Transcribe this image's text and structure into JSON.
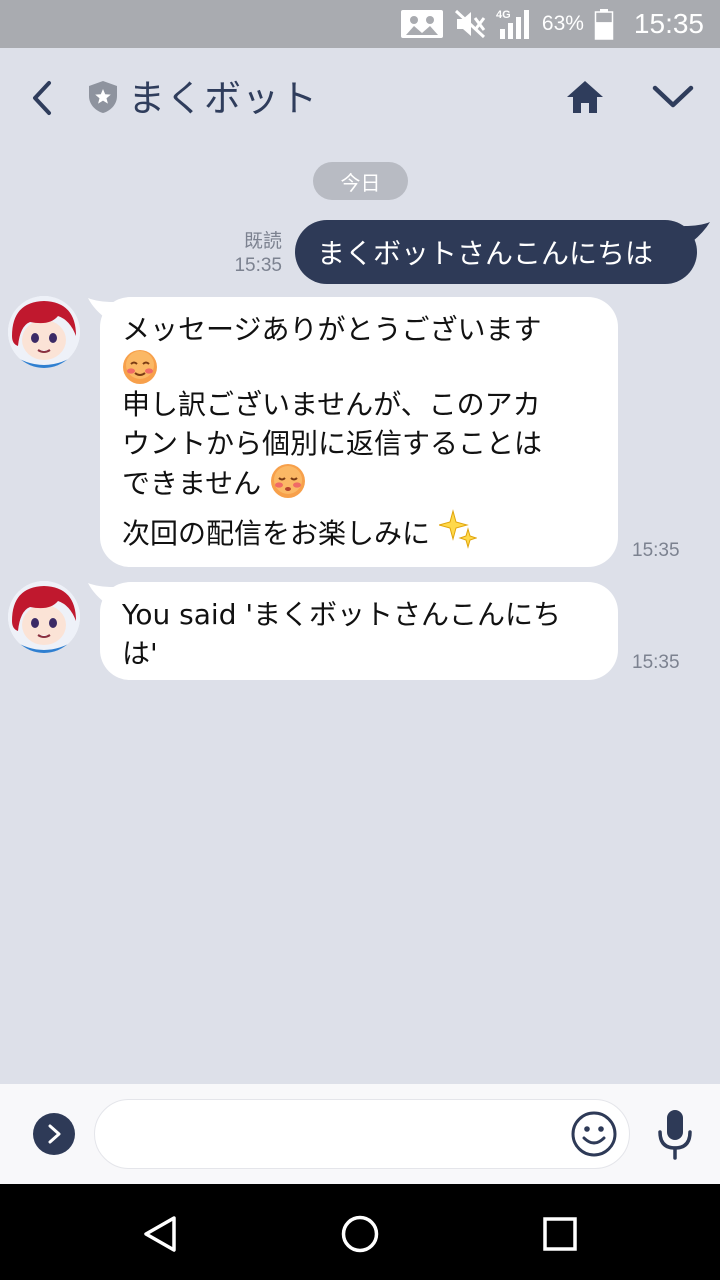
{
  "status_bar": {
    "network": "4G",
    "battery_pct": "63%",
    "battery_level": 63,
    "time": "15:35",
    "icons": [
      "photo-icon",
      "mute-icon",
      "signal-icon",
      "battery-icon"
    ]
  },
  "header": {
    "title": "まくボット",
    "icons": [
      "back-icon",
      "shield-icon",
      "home-icon",
      "chevron-down-icon"
    ]
  },
  "date_pill": "今日",
  "messages": {
    "sent": {
      "text": "まくボットさんこんにちは",
      "read_label": "既読",
      "time": "15:35"
    },
    "received": [
      {
        "lines": [
          "メッセージありがとうございます",
          "申し訳ございませんが、このアカ",
          "ウントから個別に返信することは",
          "できません",
          "次回の配信をお楽しみに"
        ],
        "emojis": [
          "smiling-blush-emoji",
          "sad-pensive-emoji",
          "sparkles-emoji"
        ],
        "time": "15:35"
      },
      {
        "lines": [
          "You said 'まくボットさんこんにち",
          "は'"
        ],
        "time": "15:35"
      }
    ]
  },
  "input_bar": {
    "placeholder": "",
    "icons": [
      "chevron-right-icon",
      "smiley-icon",
      "microphone-icon"
    ]
  },
  "nav_bar": {
    "icons": [
      "back-triangle-icon",
      "home-circle-icon",
      "recents-square-icon"
    ]
  },
  "colors": {
    "background": "#dde0e9",
    "status_bar": "#a9abb0",
    "sent_bubble": "#2e3a57",
    "title_text": "#2f3d5c",
    "received_bubble": "#ffffff",
    "meta_text": "#7c8290"
  }
}
